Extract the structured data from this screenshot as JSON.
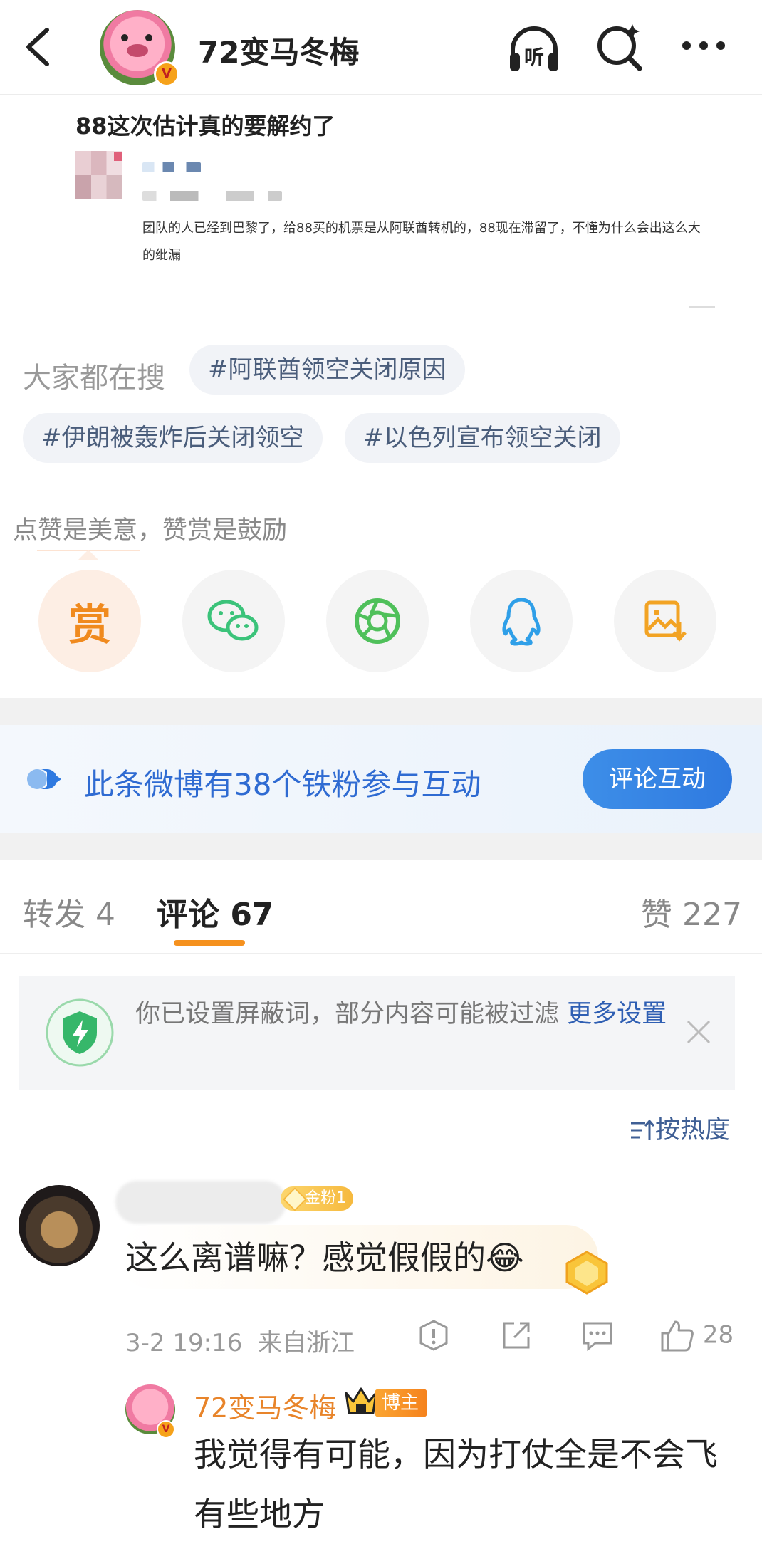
{
  "header": {
    "user_name": "72变马冬梅",
    "listen_label": "听"
  },
  "post": {
    "title": "88这次估计真的要解约了",
    "body": "团队的人已经到巴黎了，给88买的机票是从阿联酋转机的，88现在滞留了，不懂为什么会出这么大的纰漏"
  },
  "search": {
    "label": "大家都在搜",
    "tags": [
      "#阿联酋领空关闭原因",
      "#伊朗被轰炸后关闭领空",
      "#以色列宣布领空关闭"
    ]
  },
  "reward": {
    "label": "点赞是美意，赞赏是鼓励",
    "shang": "赏"
  },
  "fans": {
    "text": "此条微博有38个铁粉参与互动",
    "button": "评论互动"
  },
  "tabs": {
    "repost": "转发 4",
    "comment": "评论 67",
    "like": "赞 227"
  },
  "notice": {
    "text": "你已设置屏蔽词，部分内容可能被过滤 ",
    "link": "更多设置"
  },
  "sort": {
    "label": "按热度"
  },
  "comment": {
    "fan_badge": "金粉1",
    "text": "这么离谱嘛？感觉假假的😂",
    "time": "3-2 19:16",
    "location": "来自浙江",
    "likes": "28"
  },
  "reply": {
    "name": "72变马冬梅",
    "badge": "博主",
    "text": "我觉得有可能，因为打仗全是不会飞有些地方"
  },
  "colors": {
    "accent_orange": "#f5911e",
    "link_blue": "#2f5fb3",
    "tag_text": "#4a5d7b"
  }
}
